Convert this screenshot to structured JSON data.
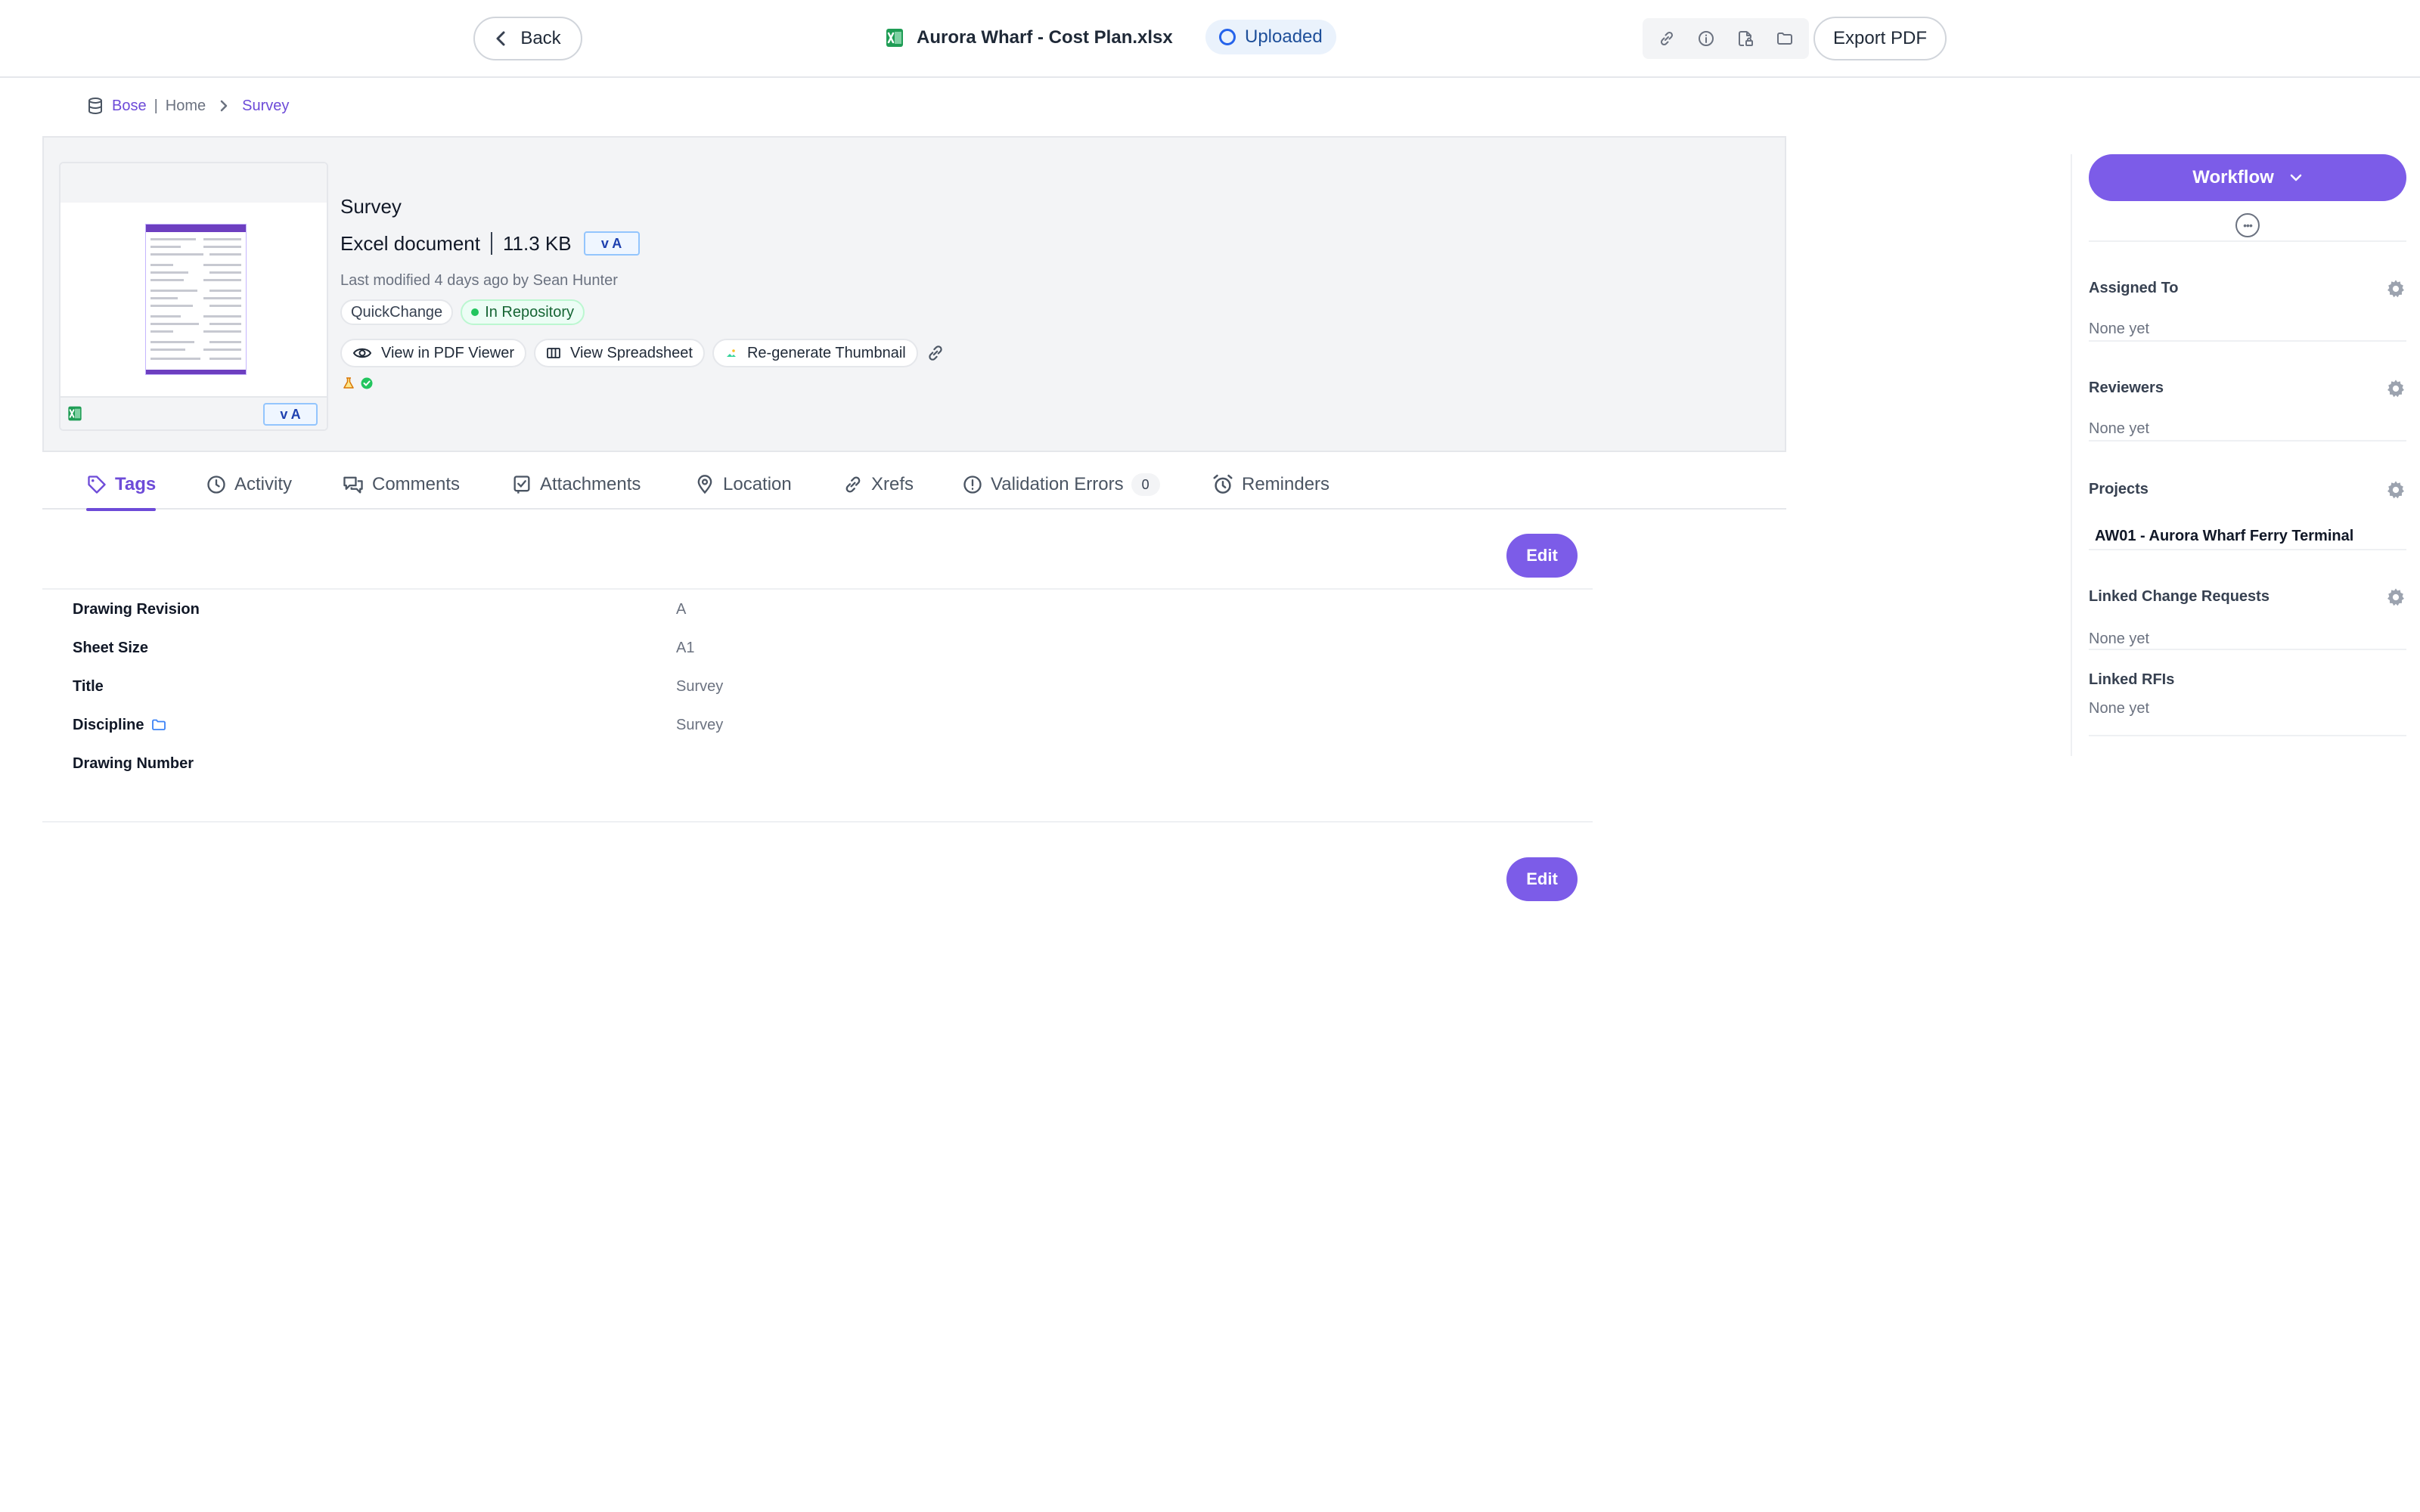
{
  "topbar": {
    "back_label": "Back",
    "file_name": "Aurora Wharf - Cost Plan.xlsx",
    "status_label": "Uploaded",
    "export_label": "Export PDF",
    "icons": [
      "link-icon",
      "info-icon",
      "file-lock-icon",
      "folder-icon"
    ]
  },
  "breadcrumb": {
    "root_link": "Bose",
    "root_sep": "|",
    "root_text": "Home",
    "current": "Survey"
  },
  "document": {
    "title": "Survey",
    "type": "Excel document",
    "size": "11.3 KB",
    "version_badge": "v A",
    "modified": "Last modified 4 days ago by Sean Hunter",
    "chips": [
      "QuickChange",
      "In Repository"
    ],
    "actions": {
      "pdf_viewer": "View in PDF Viewer",
      "spreadsheet": "View Spreadsheet",
      "regenerate": "Re-generate Thumbnail"
    }
  },
  "tabs": [
    {
      "label": "Tags",
      "icon": "tag-icon",
      "active": true
    },
    {
      "label": "Activity",
      "icon": "clock-icon",
      "active": false
    },
    {
      "label": "Comments",
      "icon": "comments-icon",
      "active": false
    },
    {
      "label": "Attachments",
      "icon": "attachment-icon",
      "active": false
    },
    {
      "label": "Location",
      "icon": "location-pin-icon",
      "active": false
    },
    {
      "label": "Xrefs",
      "icon": "link-icon",
      "active": false
    },
    {
      "label": "Validation Errors",
      "icon": "alert-circle-icon",
      "count": "0",
      "active": false
    },
    {
      "label": "Reminders",
      "icon": "alarm-clock-icon",
      "active": false
    }
  ],
  "tags_panel": {
    "edit_label": "Edit",
    "rows": [
      {
        "label": "Drawing Revision",
        "value": "A"
      },
      {
        "label": "Sheet Size",
        "value": "A1"
      },
      {
        "label": "Title",
        "value": "Survey"
      },
      {
        "label": "Discipline",
        "value": "Survey"
      },
      {
        "label": "Drawing Number",
        "value": ""
      }
    ]
  },
  "sidebar": {
    "workflow_label": "Workflow",
    "sections": [
      {
        "title": "Assigned To",
        "value": "None yet"
      },
      {
        "title": "Reviewers",
        "value": "None yet"
      },
      {
        "title": "Projects",
        "value": "AW01 - Aurora Wharf Ferry Terminal"
      },
      {
        "title": "Linked Change Requests",
        "value": "None yet"
      },
      {
        "title": "Linked RFIs",
        "value": "None yet"
      }
    ]
  },
  "colors": {
    "accent": "#7c5ce8",
    "link": "#6d4bd8",
    "status_blue": "#2563eb",
    "success_green": "#22c55e",
    "excel_green": "#1f9d55"
  }
}
